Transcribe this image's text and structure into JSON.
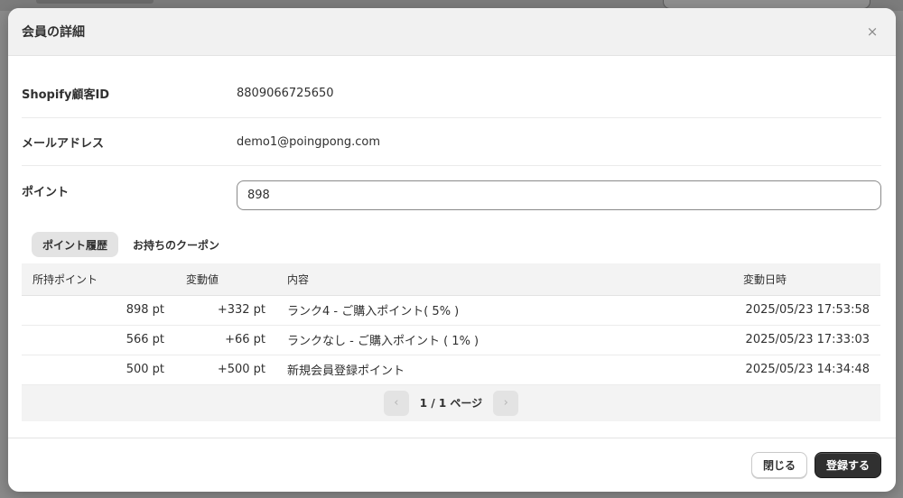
{
  "modal": {
    "title": "会員の詳細",
    "close_glyph": "×"
  },
  "fields": {
    "customer_id": {
      "label": "Shopify顧客ID",
      "value": "8809066725650"
    },
    "email": {
      "label": "メールアドレス",
      "value": "demo1@poingpong.com"
    },
    "points": {
      "label": "ポイント",
      "value": "898"
    }
  },
  "tabs": [
    {
      "label": "ポイント履歴",
      "active": true
    },
    {
      "label": "お持ちのクーポン",
      "active": false
    }
  ],
  "history_table": {
    "columns": [
      "所持ポイント",
      "変動値",
      "内容",
      "変動日時"
    ],
    "rows": [
      {
        "held": "898 pt",
        "change": "+332 pt",
        "detail": "ランク4 - ご購入ポイント( 5% )",
        "date": "2025/05/23 17:53:58"
      },
      {
        "held": "566 pt",
        "change": "+66 pt",
        "detail": "ランクなし - ご購入ポイント ( 1% )",
        "date": "2025/05/23 17:33:03"
      },
      {
        "held": "500 pt",
        "change": "+500 pt",
        "detail": "新規会員登録ポイント",
        "date": "2025/05/23 14:34:48"
      }
    ]
  },
  "pagination": {
    "label": "1 / 1 ページ",
    "prev_glyph": "‹",
    "next_glyph": "›"
  },
  "footer": {
    "close_label": "閉じる",
    "submit_label": "登録する"
  },
  "icons": {
    "close": "close-icon",
    "prev": "chevron-left-icon",
    "next": "chevron-right-icon"
  },
  "colors": {
    "primary_button": "#303030",
    "header_bg": "#f1f1f1",
    "table_header_bg": "#f3f3f3"
  }
}
